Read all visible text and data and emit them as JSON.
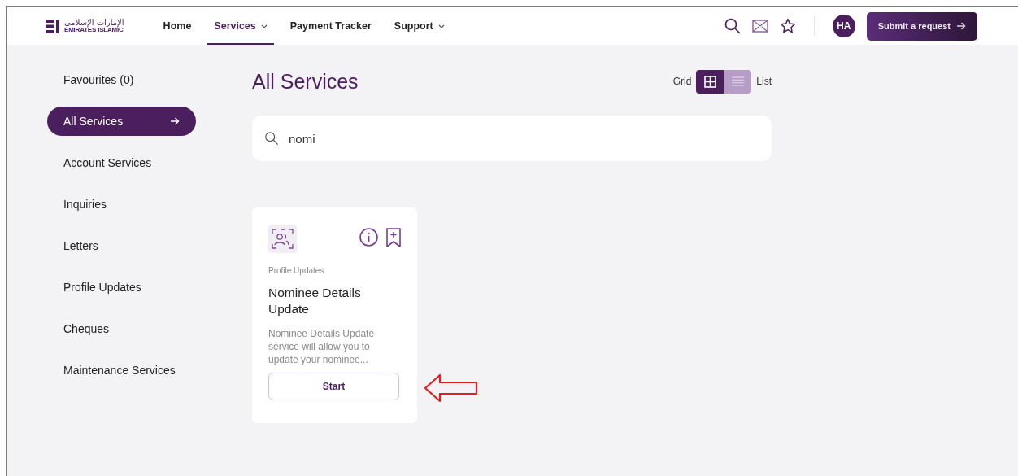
{
  "header": {
    "logo": {
      "arabic": "الإمارات الإسلامي",
      "latin": "EMIRATES ISLAMIC"
    },
    "nav": [
      {
        "label": "Home",
        "selected": false,
        "dropdown": false
      },
      {
        "label": "Services",
        "selected": true,
        "dropdown": true
      },
      {
        "label": "Payment Tracker",
        "selected": false,
        "dropdown": false
      },
      {
        "label": "Support",
        "selected": false,
        "dropdown": true
      }
    ],
    "avatar": "HA",
    "submit_button": "Submit a request"
  },
  "sidebar": {
    "items": [
      {
        "label": "Favourites (0)",
        "selected": false
      },
      {
        "label": "All Services",
        "selected": true
      },
      {
        "label": "Account Services",
        "selected": false
      },
      {
        "label": "Inquiries",
        "selected": false
      },
      {
        "label": "Letters",
        "selected": false
      },
      {
        "label": "Profile Updates",
        "selected": false
      },
      {
        "label": "Cheques",
        "selected": false
      },
      {
        "label": "Maintenance Services",
        "selected": false
      }
    ]
  },
  "main": {
    "title": "All Services",
    "view_toggle": {
      "grid_label": "Grid",
      "list_label": "List",
      "options": [
        {
          "kind": "grid",
          "selected": true
        },
        {
          "kind": "list",
          "selected": false
        }
      ]
    },
    "search": {
      "value": "nomi"
    },
    "cards": [
      {
        "category": "Profile Updates",
        "title": "Nominee Details Update",
        "description": "Nominee Details Update service will allow you to update your nominee...",
        "button": "Start"
      }
    ]
  }
}
